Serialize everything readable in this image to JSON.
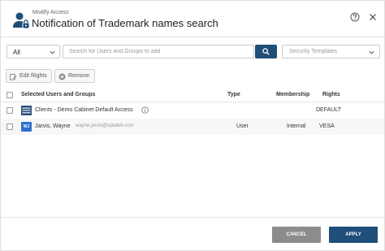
{
  "header": {
    "subtitle": "Modify Access",
    "title": "Notification of Trademark names search",
    "icon": "user-lock-icon",
    "help_icon": "help-circle-icon",
    "close_icon": "close-icon"
  },
  "filter": {
    "scope_value": "All",
    "search_placeholder": "Search for Users and Groups to add",
    "search_value": "",
    "security_placeholder": "Security Templates"
  },
  "actions": {
    "edit_label": "Edit Rights",
    "remove_label": "Remove"
  },
  "table": {
    "columns": [
      "Selected Users and Groups",
      "Type",
      "Membership",
      "Rights"
    ],
    "rows": [
      {
        "name": "Clients - Demo Cabinet Default Access",
        "email": "",
        "type": "",
        "membership": "",
        "rights": "DEFAULT"
      },
      {
        "initials": "WJ",
        "name": "Jarvis, Wayne",
        "email": "wayne.jarvis@optable.com",
        "type": "User",
        "membership": "Internal",
        "rights": "VESA"
      }
    ]
  },
  "footer": {
    "cancel_label": "CANCEL",
    "apply_label": "APPLY"
  },
  "colors": {
    "primary": "#1f4e79",
    "cancel": "#8c8c8c",
    "avatar": "#2e6fcf"
  }
}
